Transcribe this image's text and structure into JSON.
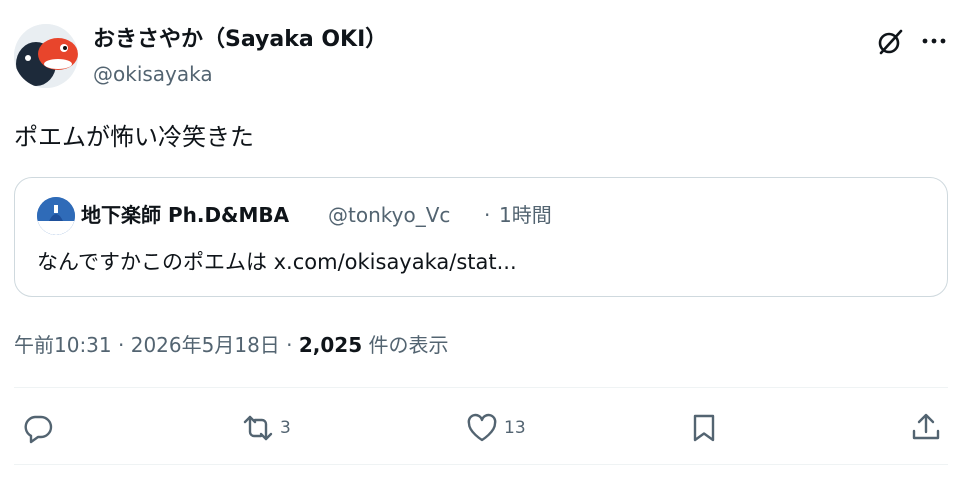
{
  "author": {
    "display_name": "おきさやか（Sayaka OKI）",
    "handle": "@okisayaka"
  },
  "tweet": {
    "text": "ポエムが怖い冷笑きた"
  },
  "quote": {
    "display_name": "地下楽師 Ph.D&MBA",
    "handle": "@tonkyo_Vc",
    "separator": "·",
    "time": "1時間",
    "text": "なんですかこのポエムは x.com/okisayaka/stat..."
  },
  "meta": {
    "time": "午前10:31",
    "separator": "·",
    "date": "2026年5月18日",
    "separator2": "·",
    "views": "2,025",
    "views_label": "件の表示"
  },
  "actions": {
    "reply_count": "",
    "retweet_count": "3",
    "like_count": "13"
  },
  "icons": [
    "grok-icon",
    "more-icon",
    "reply-icon",
    "retweet-icon",
    "like-icon",
    "bookmark-icon",
    "share-icon"
  ],
  "colors": {
    "text_primary": "#0f1419",
    "text_secondary": "#536471",
    "border": "#cfd9de"
  }
}
